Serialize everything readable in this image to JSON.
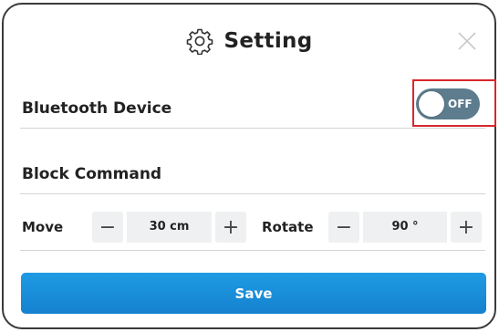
{
  "dialog": {
    "title": "Setting",
    "title_icon": "gear-icon",
    "close_icon": "close-icon"
  },
  "bluetooth": {
    "label": "Bluetooth Device",
    "toggle_state": "OFF",
    "toggle_color": "#5d7d8f",
    "highlight_color": "#d9262c"
  },
  "block_command": {
    "label": "Block Command",
    "move": {
      "label": "Move",
      "value": "30 cm",
      "minus": "−",
      "plus": "+"
    },
    "rotate": {
      "label": "Rotate",
      "value": "90 °",
      "minus": "−",
      "plus": "+"
    }
  },
  "save": {
    "label": "Save",
    "color": "#1a8fd9"
  }
}
